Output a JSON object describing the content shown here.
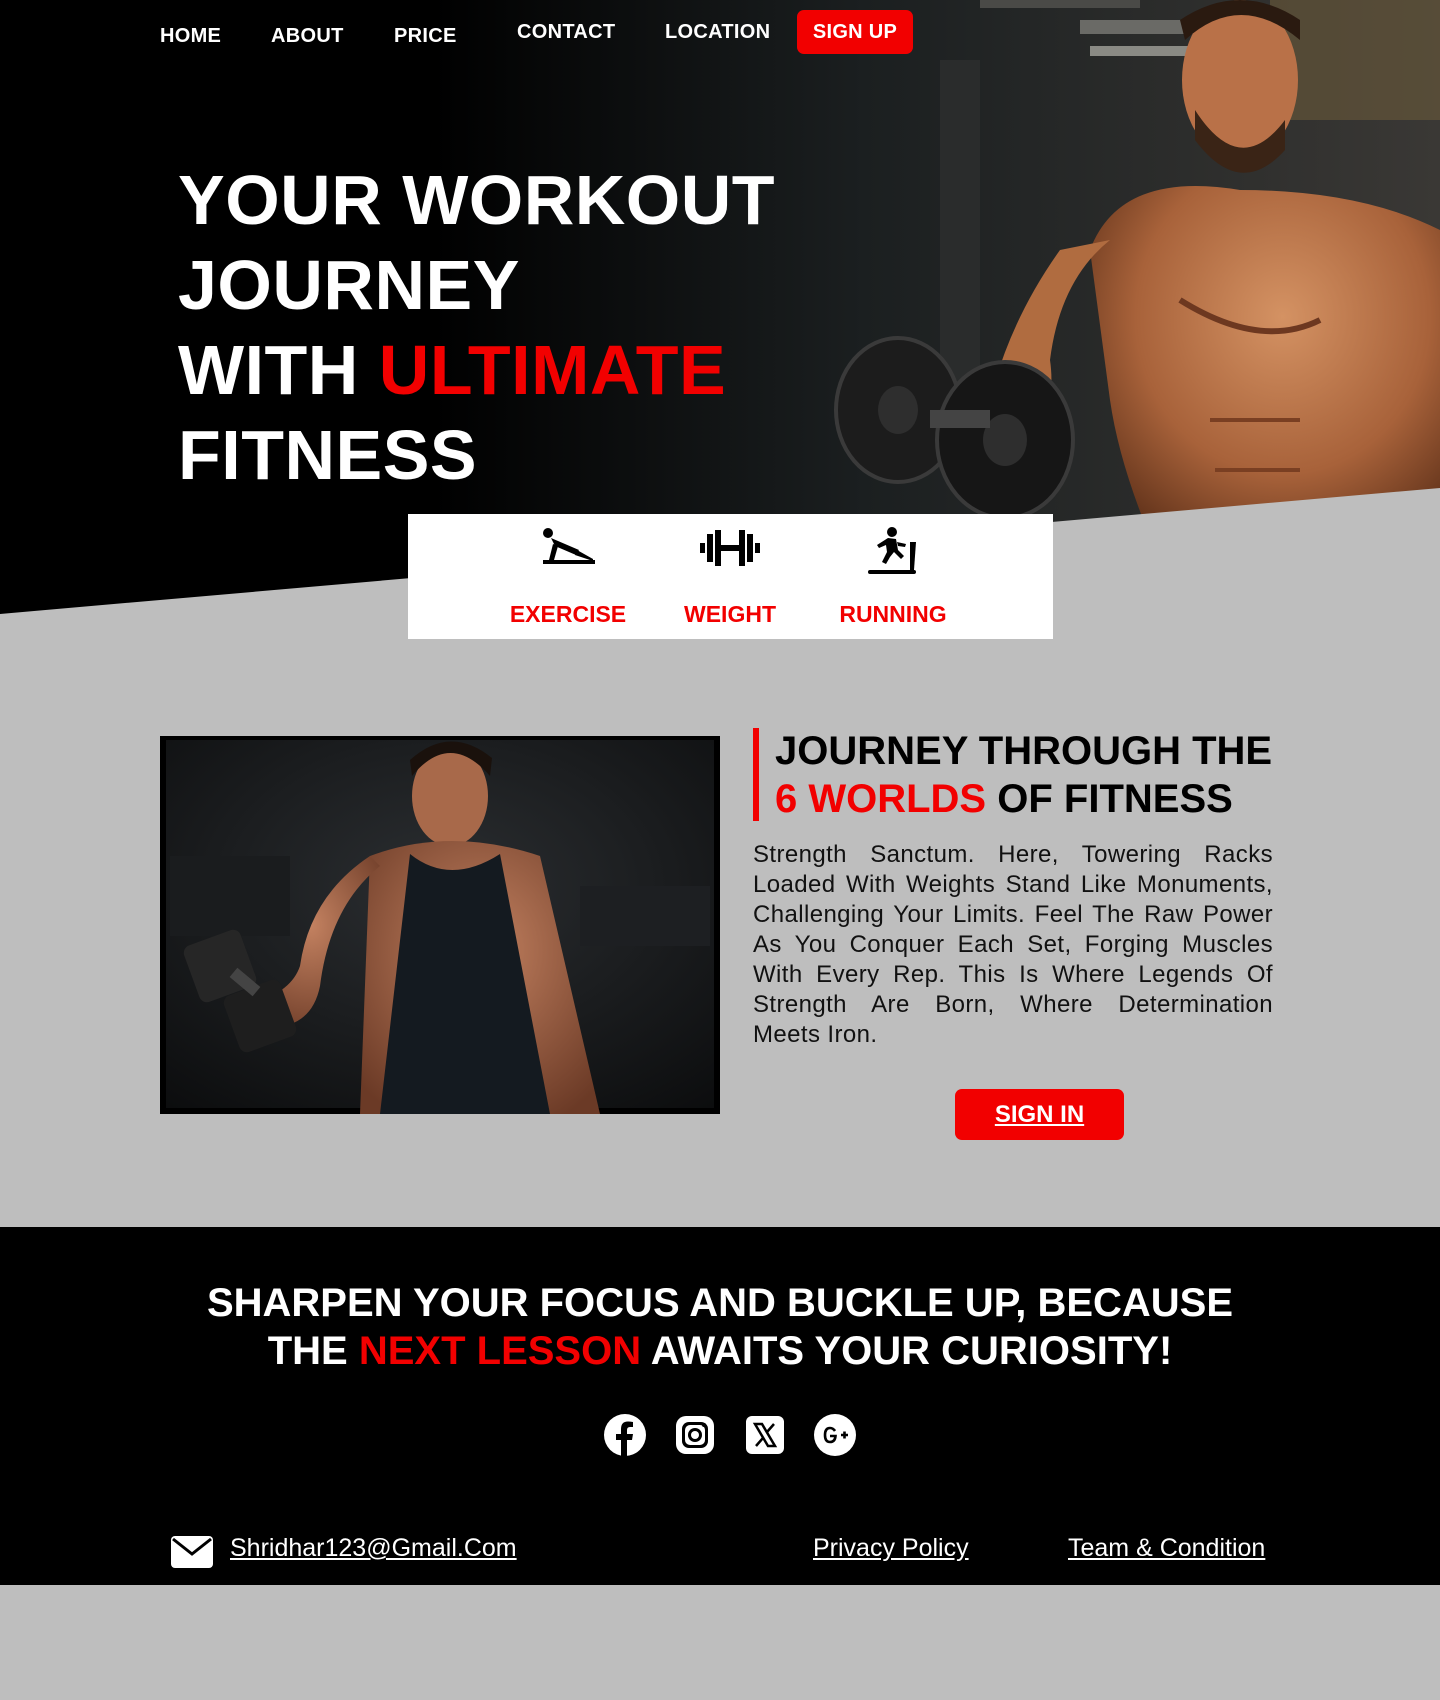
{
  "nav": {
    "home": "HOME",
    "about": "ABOUT",
    "price": "PRICE",
    "contact": "CONTACT",
    "location": "LOCATION",
    "signup": "SIGN UP"
  },
  "hero": {
    "line1": "YOUR WORKOUT",
    "line2": "JOURNEY",
    "line3a": "WITH ",
    "line3b": "ULTIMATE",
    "line4": "FITNESS"
  },
  "features": [
    {
      "label": "EXERCISE",
      "icon": "pushup-icon"
    },
    {
      "label": "WEIGHT",
      "icon": "barbell-icon"
    },
    {
      "label": "RUNNING",
      "icon": "treadmill-runner-icon"
    }
  ],
  "section2": {
    "title_line1": "JOURNEY THROUGH THE",
    "title_red": "6 WORLDS",
    "title_rest": " OF FITNESS",
    "body": "Strength Sanctum. Here, Towering Racks Loaded With Weights Stand Like Monuments, Challenging Your Limits. Feel The Raw Power As You Conquer Each Set, Forging Muscles With Every Rep. This Is Where Legends Of Strength Are Born, Where Determination Meets Iron.",
    "button": "SIGN IN"
  },
  "footer": {
    "line1": "SHARPEN YOUR FOCUS AND BUCKLE UP, BECAUSE",
    "line2a": "THE ",
    "line2red": "NEXT LESSON",
    "line2b": " AWAITS YOUR CURIOSITY!",
    "social": [
      "facebook-icon",
      "instagram-icon",
      "x-icon",
      "google-plus-icon"
    ],
    "email": "Shridhar123@Gmail.Com",
    "privacy": "Privacy Policy",
    "terms": "Team & Condition"
  },
  "colors": {
    "accent": "#f20000",
    "dark": "#000000",
    "light_bg": "#bebebe"
  }
}
